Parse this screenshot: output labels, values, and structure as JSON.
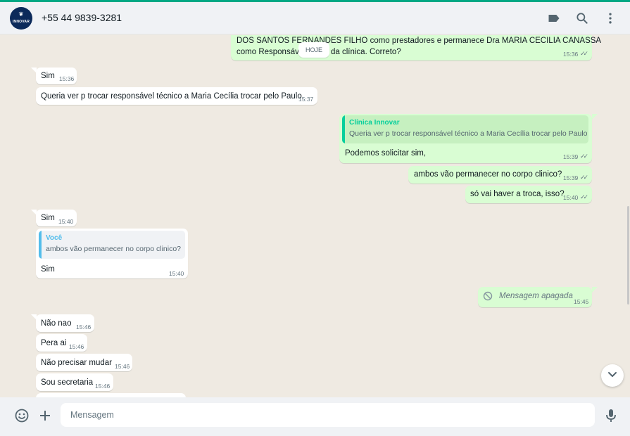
{
  "header": {
    "avatar_text": "INNOVAR",
    "contact_number": "+55 44 9839-3281"
  },
  "chat": {
    "date_chip": "HOJE",
    "first_out": {
      "line1": "DOS SANTOS FERNANDES FILHO como prestadores e permanece Dra MARIA CECILIA CANASSA",
      "line2a": "como Responsáve",
      "line2b": "da clínica. Correto?",
      "time": "15:36"
    },
    "m1": {
      "text": "Sim",
      "time": "15:36"
    },
    "m2": {
      "text": "Queria ver p trocar responsável técnico a Maria Cecília trocar pelo Paulo",
      "time": "15:37"
    },
    "m3": {
      "quote_author": "Clínica Innovar",
      "quote_text": "Queria ver p trocar responsável técnico a Maria Cecília trocar pelo Paulo",
      "text": "Podemos solicitar sim,",
      "time": "15:39"
    },
    "m4": {
      "text": "ambos vão permanecer no corpo clinico?",
      "time": "15:39"
    },
    "m5": {
      "text": "só vai haver a troca, isso?",
      "time": "15:40"
    },
    "m6": {
      "text": "Sim",
      "time": "15:40"
    },
    "m7": {
      "quote_author": "Você",
      "quote_text": "ambos vão permanecer no corpo clinico?",
      "text": "Sim",
      "time": "15:40"
    },
    "m8": {
      "text": "Mensagem apagada",
      "time": "15:45"
    },
    "m9": {
      "text": "Não nao",
      "time": "15:46"
    },
    "m10": {
      "text": "Pera ai",
      "time": "15:46"
    },
    "m11": {
      "text": "Não precisar mudar",
      "time": "15:46"
    },
    "m12": {
      "text": "Sou secretaria",
      "time": "15:46"
    }
  },
  "footer": {
    "input_placeholder": "Mensagem"
  },
  "colors": {
    "accent": "#00a884",
    "outgoing_bubble": "#d9fdd3",
    "incoming_bubble": "#ffffff",
    "chat_background": "#efeae2",
    "quote_own": "#06cf9c",
    "quote_other": "#53bdeb",
    "ticks": "#667781"
  },
  "icons": {
    "label": "label-icon",
    "search": "search-icon",
    "menu": "menu-dots-icon",
    "emoji": "emoji-icon",
    "attach": "plus-icon",
    "mic": "mic-icon",
    "scroll": "chevron-down-icon",
    "deleted": "deleted-message-icon"
  }
}
